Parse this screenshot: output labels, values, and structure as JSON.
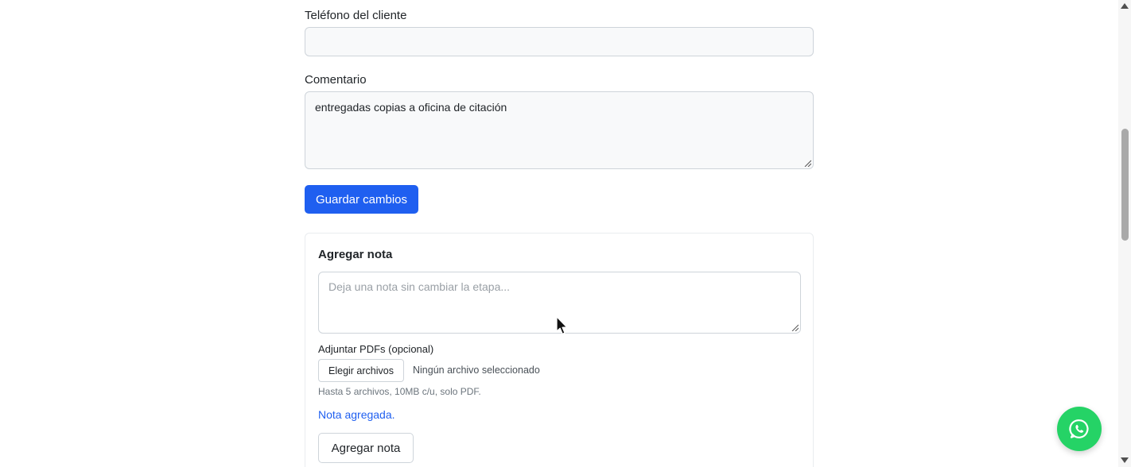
{
  "form": {
    "phone_label": "Teléfono del cliente",
    "phone_value": "",
    "comment_label": "Comentario",
    "comment_value": "entregadas copias  a oficina de citación",
    "save_button": "Guardar cambios"
  },
  "note_card": {
    "title": "Agregar nota",
    "placeholder": "Deja una nota sin cambiar la etapa...",
    "attach_label": "Adjuntar PDFs (opcional)",
    "choose_files_button": "Elegir archivos",
    "file_status": "Ningún archivo seleccionado",
    "hint": "Hasta 5 archivos, 10MB c/u, solo PDF.",
    "success_message": "Nota agregada.",
    "submit_button": "Agregar nota"
  },
  "icons": {
    "chat_fab": "whatsapp-icon",
    "cursor": "mouse-pointer-icon"
  },
  "colors": {
    "primary": "#1f5ff0",
    "whatsapp": "#25d366"
  }
}
